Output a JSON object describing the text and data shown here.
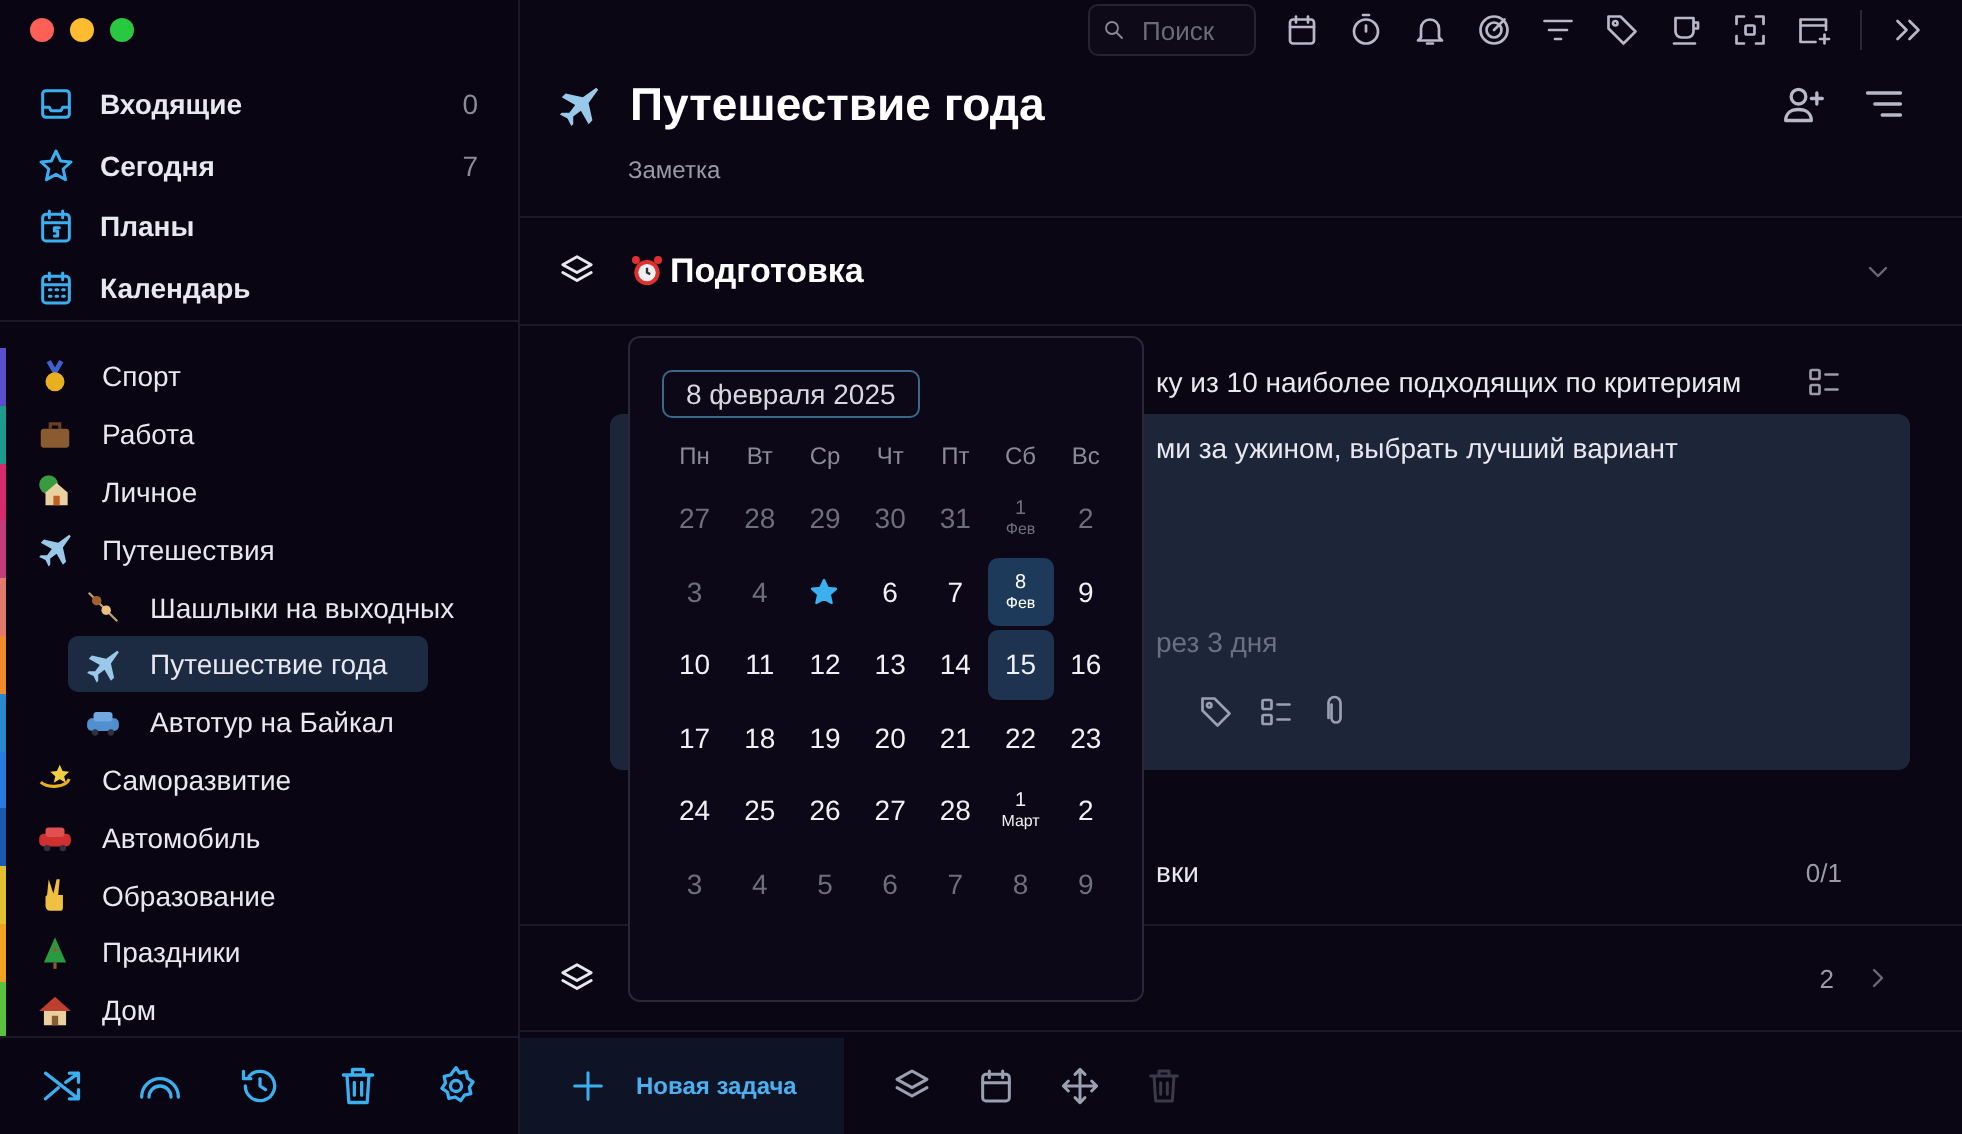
{
  "sidebar": {
    "nav": [
      {
        "label": "Входящие",
        "count": "0"
      },
      {
        "label": "Сегодня",
        "count": "7"
      },
      {
        "label": "Планы"
      },
      {
        "label": "Календарь"
      }
    ],
    "projects": [
      {
        "label": "Спорт",
        "color": "#5a4fd0",
        "selected": false
      },
      {
        "label": "Работа",
        "color": "#1f9a8a",
        "selected": false
      },
      {
        "label": "Личное",
        "color": "#d62a6a",
        "selected": false
      },
      {
        "label": "Путешествия",
        "color": "#c43a7a",
        "selected": false,
        "children": [
          {
            "label": "Шашлыки на выходных",
            "color": "#e07a6a",
            "selected": false
          },
          {
            "label": "Путешествие года",
            "color": "#f08a2a",
            "selected": true
          },
          {
            "label": "Автотур на Байкал",
            "color": "#2a8ad0",
            "selected": false
          }
        ]
      },
      {
        "label": "Саморазвитие",
        "color": "#2a7ae0",
        "selected": false
      },
      {
        "label": "Автомобиль",
        "color": "#1a5ab0",
        "selected": false
      },
      {
        "label": "Образование",
        "color": "#e0c030",
        "selected": false
      },
      {
        "label": "Праздники",
        "color": "#f0a020",
        "selected": false
      },
      {
        "label": "Дом",
        "color": "#5ac040",
        "selected": false
      }
    ]
  },
  "toolbar": {
    "search": {
      "placeholder": "Поиск"
    }
  },
  "header": {
    "title": "Путешествие года",
    "subtitle": "Заметка"
  },
  "section": {
    "title": "Подготовка"
  },
  "tasks": [
    {
      "kind": "row",
      "text": "ку из 10 наиболее подходящих по критериям"
    },
    {
      "kind": "card",
      "text": "ми за ужином, выбрать лучший вариант",
      "due": "рез 3 дня"
    },
    {
      "kind": "row",
      "text": "вки",
      "count": "0/1"
    }
  ],
  "section_2": {
    "count": "2"
  },
  "bottom_bar": {
    "new_task": "Новая задача",
    "tools": [
      {
        "disabled": false
      },
      {
        "disabled": false
      },
      {
        "disabled": false
      },
      {
        "disabled": true
      }
    ]
  },
  "date_picker": {
    "value": "8 февраля 2025",
    "weekdays": [
      "Пн",
      "Вт",
      "Ср",
      "Чт",
      "Пт",
      "Сб",
      "Вс"
    ],
    "weeks": [
      [
        {
          "kind": "day",
          "day": "27",
          "muted": true,
          "selected": false,
          "marked": false
        },
        {
          "kind": "day",
          "day": "28",
          "muted": true,
          "selected": false,
          "marked": false
        },
        {
          "kind": "day",
          "day": "29",
          "muted": true,
          "selected": false,
          "marked": false
        },
        {
          "kind": "day",
          "day": "30",
          "muted": true,
          "selected": false,
          "marked": false
        },
        {
          "kind": "day",
          "day": "31",
          "muted": true,
          "selected": false,
          "marked": false
        },
        {
          "kind": "day",
          "day": "1",
          "sub": "Фев",
          "muted": true,
          "selected": false,
          "marked": false
        },
        {
          "kind": "day",
          "day": "2",
          "muted": true,
          "selected": false,
          "marked": false
        }
      ],
      [
        {
          "kind": "day",
          "day": "3",
          "muted": true,
          "selected": false,
          "marked": false
        },
        {
          "kind": "day",
          "day": "4",
          "muted": true,
          "selected": false,
          "marked": false
        },
        {
          "kind": "today",
          "selected": false,
          "marked": false
        },
        {
          "kind": "day",
          "day": "6",
          "muted": false,
          "selected": false,
          "marked": false
        },
        {
          "kind": "day",
          "day": "7",
          "muted": false,
          "selected": false,
          "marked": false
        },
        {
          "kind": "day",
          "day": "8",
          "sub": "Фев",
          "muted": false,
          "selected": true,
          "marked": false
        },
        {
          "kind": "day",
          "day": "9",
          "muted": false,
          "selected": false,
          "marked": false
        }
      ],
      [
        {
          "kind": "day",
          "day": "10",
          "muted": false,
          "selected": false,
          "marked": false
        },
        {
          "kind": "day",
          "day": "11",
          "muted": false,
          "selected": false,
          "marked": false
        },
        {
          "kind": "day",
          "day": "12",
          "muted": false,
          "selected": false,
          "marked": false
        },
        {
          "kind": "day",
          "day": "13",
          "muted": false,
          "selected": false,
          "marked": false
        },
        {
          "kind": "day",
          "day": "14",
          "muted": false,
          "selected": false,
          "marked": false
        },
        {
          "kind": "day",
          "day": "15",
          "muted": false,
          "selected": false,
          "marked": true
        },
        {
          "kind": "day",
          "day": "16",
          "muted": false,
          "selected": false,
          "marked": false
        }
      ],
      [
        {
          "kind": "day",
          "day": "17",
          "muted": false,
          "selected": false,
          "marked": false
        },
        {
          "kind": "day",
          "day": "18",
          "muted": false,
          "selected": false,
          "marked": false
        },
        {
          "kind": "day",
          "day": "19",
          "muted": false,
          "selected": false,
          "marked": false
        },
        {
          "kind": "day",
          "day": "20",
          "muted": false,
          "selected": false,
          "marked": false
        },
        {
          "kind": "day",
          "day": "21",
          "muted": false,
          "selected": false,
          "marked": false
        },
        {
          "kind": "day",
          "day": "22",
          "muted": false,
          "selected": false,
          "marked": false
        },
        {
          "kind": "day",
          "day": "23",
          "muted": false,
          "selected": false,
          "marked": false
        }
      ],
      [
        {
          "kind": "day",
          "day": "24",
          "muted": false,
          "selected": false,
          "marked": false
        },
        {
          "kind": "day",
          "day": "25",
          "muted": false,
          "selected": false,
          "marked": false
        },
        {
          "kind": "day",
          "day": "26",
          "muted": false,
          "selected": false,
          "marked": false
        },
        {
          "kind": "day",
          "day": "27",
          "muted": false,
          "selected": false,
          "marked": false
        },
        {
          "kind": "day",
          "day": "28",
          "muted": false,
          "selected": false,
          "marked": false
        },
        {
          "kind": "day",
          "day": "1",
          "sub": "Март",
          "muted": false,
          "selected": false,
          "marked": false
        },
        {
          "kind": "day",
          "day": "2",
          "muted": false,
          "selected": false,
          "marked": false
        }
      ],
      [
        {
          "kind": "day",
          "day": "3",
          "muted": true,
          "selected": false,
          "marked": false
        },
        {
          "kind": "day",
          "day": "4",
          "muted": true,
          "selected": false,
          "marked": false
        },
        {
          "kind": "day",
          "day": "5",
          "muted": true,
          "selected": false,
          "marked": false
        },
        {
          "kind": "day",
          "day": "6",
          "muted": true,
          "selected": false,
          "marked": false
        },
        {
          "kind": "day",
          "day": "7",
          "muted": true,
          "selected": false,
          "marked": false
        },
        {
          "kind": "day",
          "day": "8",
          "muted": true,
          "selected": false,
          "marked": false
        },
        {
          "kind": "day",
          "day": "9",
          "muted": true,
          "selected": false,
          "marked": false
        }
      ]
    ]
  }
}
